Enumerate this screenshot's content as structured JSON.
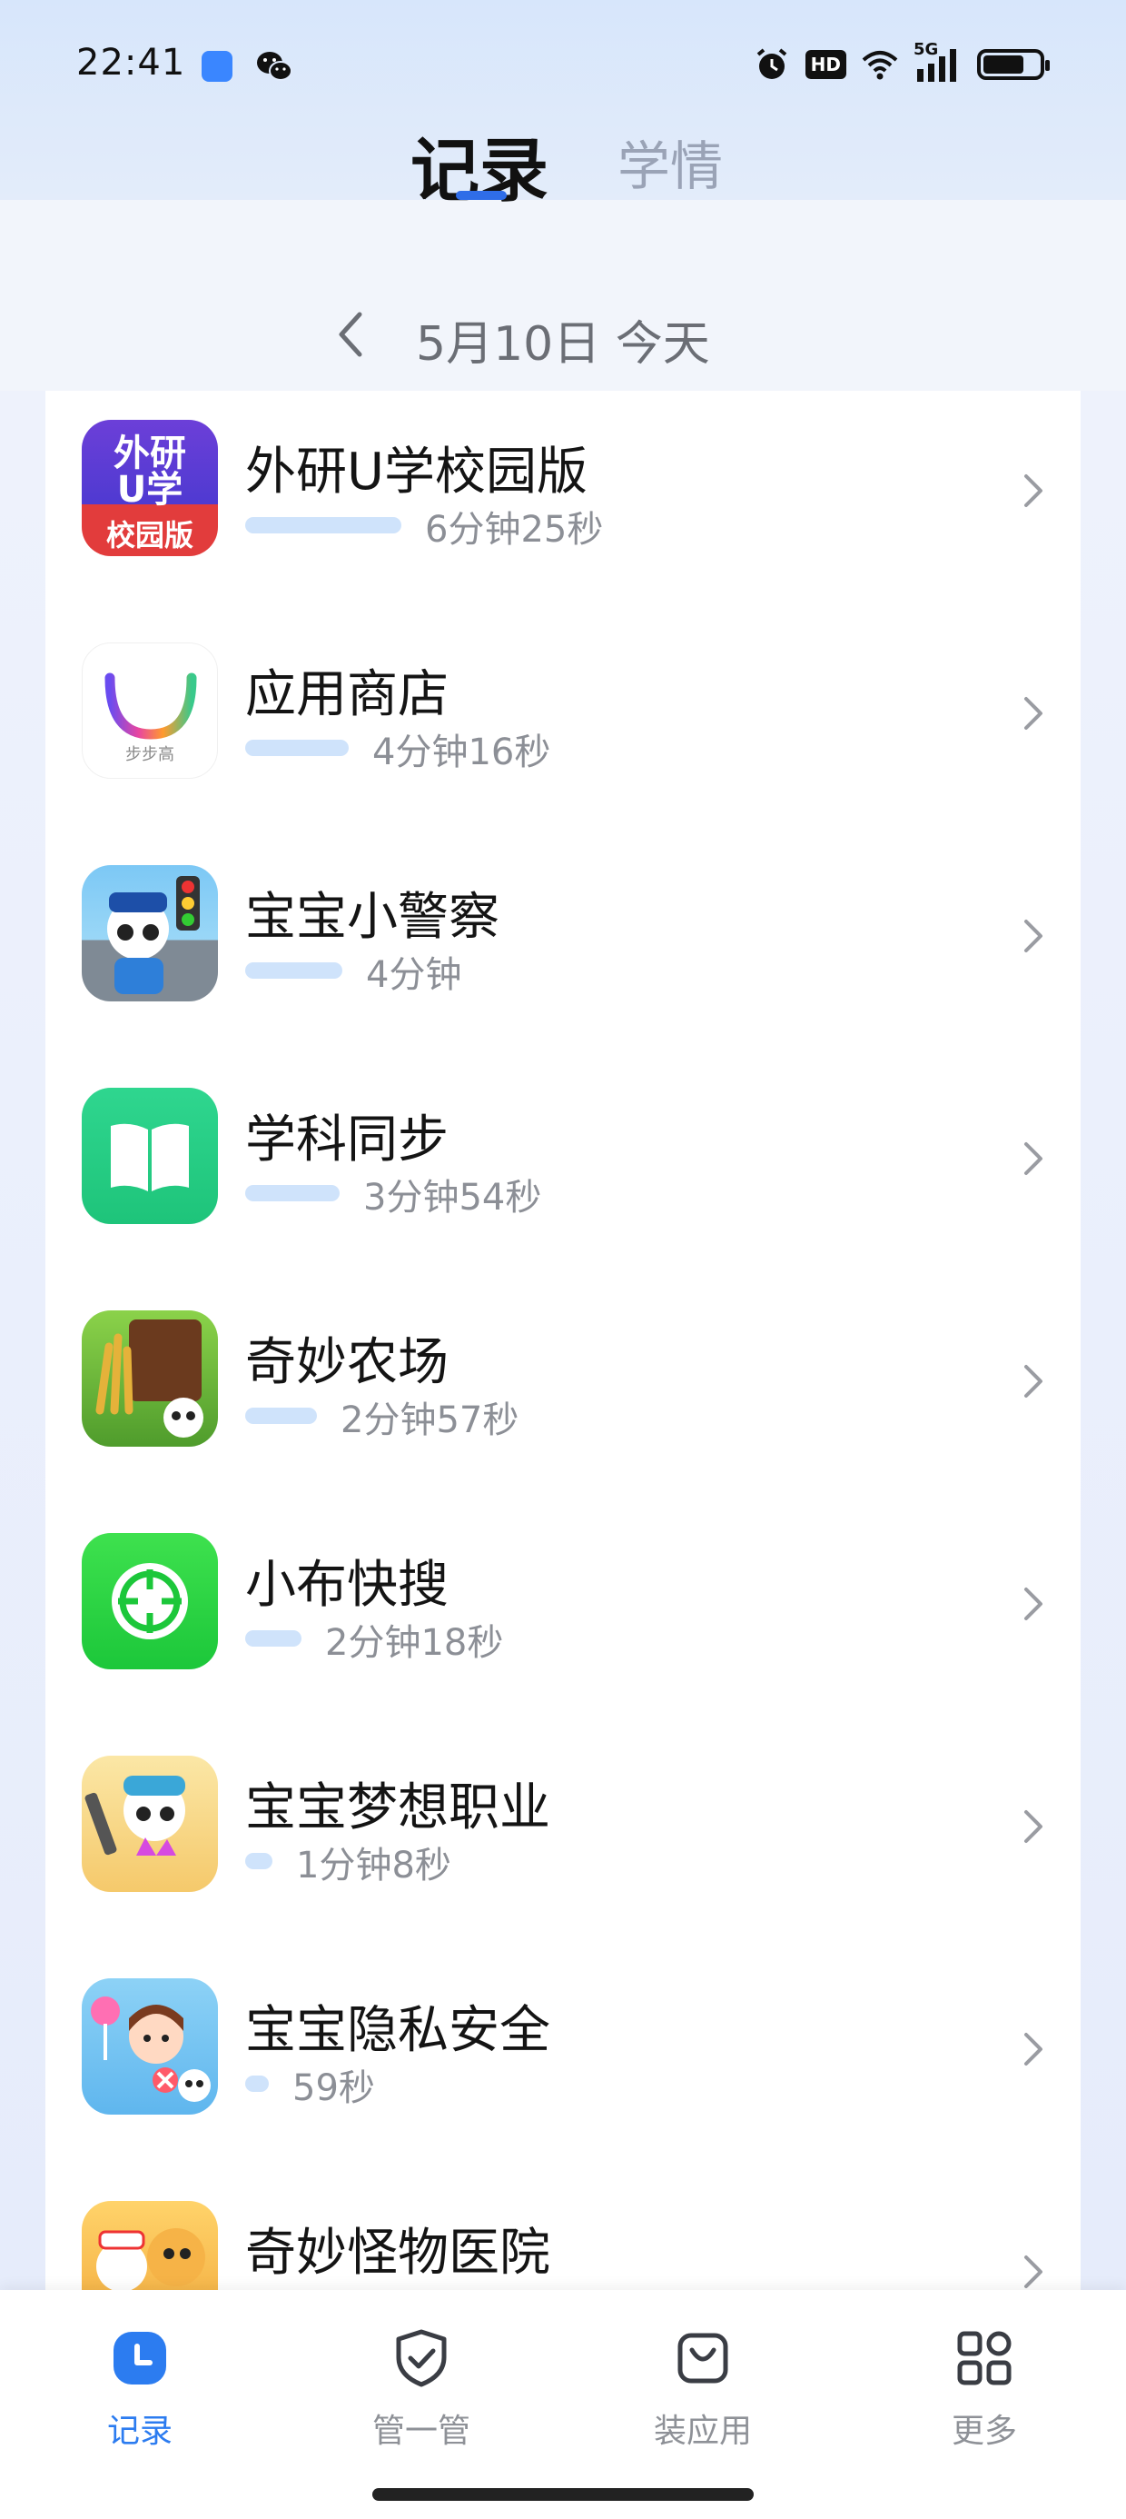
{
  "status_bar": {
    "time": "22:41",
    "hd_badge": "HD",
    "network": "5G",
    "battery_level": 0.75
  },
  "header": {
    "tabs": [
      {
        "label": "记录",
        "active": true
      },
      {
        "label": "学情",
        "active": false
      }
    ]
  },
  "date_nav": {
    "label": "5月10日 今天",
    "prev_icon": "chevron-left-icon"
  },
  "accent_color": "#2c7cf0",
  "usage_list": [
    {
      "name": "外研U学校园版",
      "duration": "6分钟25秒",
      "minutes": 6.42,
      "icon_text_top": "外研",
      "icon_text_mid": "U学",
      "icon_text_bottom": "校园版"
    },
    {
      "name": "应用商店",
      "duration": "4分钟16秒",
      "minutes": 4.27,
      "icon_text_bottom": "步步高"
    },
    {
      "name": "宝宝小警察",
      "duration": "4分钟",
      "minutes": 4.0
    },
    {
      "name": "学科同步",
      "duration": "3分钟54秒",
      "minutes": 3.9
    },
    {
      "name": "奇妙农场",
      "duration": "2分钟57秒",
      "minutes": 2.95
    },
    {
      "name": "小布快搜",
      "duration": "2分钟18秒",
      "minutes": 2.3
    },
    {
      "name": "宝宝梦想职业",
      "duration": "1分钟8秒",
      "minutes": 1.13
    },
    {
      "name": "宝宝隐私安全",
      "duration": "59秒",
      "minutes": 0.98
    },
    {
      "name": "奇妙怪物医院",
      "duration": "",
      "minutes": 0.8
    }
  ],
  "bottom_nav": [
    {
      "label": "记录",
      "icon": "clock-icon",
      "active": true
    },
    {
      "label": "管一管",
      "icon": "shield-check-icon",
      "active": false
    },
    {
      "label": "装应用",
      "icon": "shopping-bag-icon",
      "active": false
    },
    {
      "label": "更多",
      "icon": "grid-icon",
      "active": false
    }
  ]
}
